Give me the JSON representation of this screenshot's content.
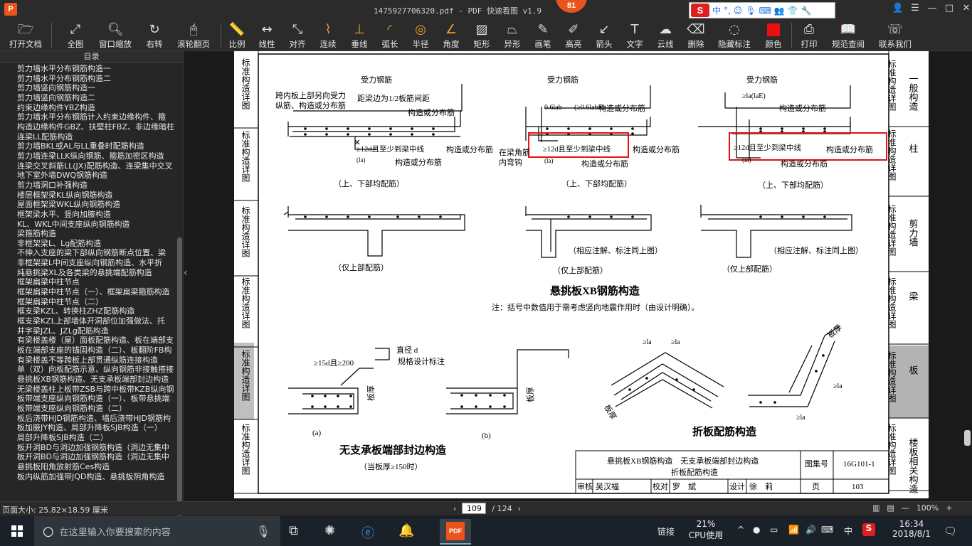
{
  "titlebar": {
    "logo": "P",
    "title": "1475927706320.pdf - PDF 快速看图 v1.9",
    "badge": "81",
    "ime_logo": "S",
    "ime_lang": "中",
    "minimize": "—",
    "maximize": "□",
    "close": "✕"
  },
  "toolbar": {
    "items": [
      "打开文档",
      "全图",
      "窗口缩放",
      "右转",
      "滚轮翻页",
      "比例",
      "线性",
      "对齐",
      "连续",
      "垂线",
      "弧长",
      "半径",
      "角度",
      "矩形",
      "异形",
      "画笔",
      "高亮",
      "箭头",
      "文字",
      "云线",
      "删除",
      "隐藏标注",
      "颜色",
      "打印",
      "规范查阅",
      "联系我们"
    ],
    "color_accent": "#e8a030",
    "highlight_red": "#e81010"
  },
  "sidebar": {
    "header": "目录",
    "items": [
      "剪力墙水平分布钢筋构造一",
      "剪力墙水平分布钢筋构造二",
      "剪力墙竖向钢筋构造一",
      "剪力墙竖向钢筋构造二",
      "约束边缘构件YBZ构造",
      "剪力墙水平分布钢筋计入约束边缘构件、箍",
      "构造边缘构件GBZ、扶壁柱FBZ、非边缘暗柱",
      "连梁LL配筋构造",
      "剪力墙BKL或AL与LL重叠时配筋构造",
      "剪力墙连梁LLK纵向钢筋、箍筋加密区构造",
      "连梁交叉斜筋LL(JX)配筋构造、连梁集中交叉",
      "地下室外墙DWQ钢筋构造",
      "剪力墙洞口补强构造",
      "楼层框架梁KL纵向钢筋构造",
      "屋面框架梁WKL纵向钢筋构造",
      "框架梁水平、竖向加腋构造",
      "KL、WKL中间支座纵向钢筋构造",
      "梁箍筋构造",
      "非框架梁L、Lg配筋构造",
      "不伸入支座的梁下部纵向钢筋断点位置、梁",
      "非框架梁L中间支座纵向钢筋构造、水平折",
      "纯悬挑梁XL及各类梁的悬挑端配筋构造",
      "框架扁梁中柱节点",
      "框架扁梁中柱节点（一）、框架扁梁箍筋构造",
      "框架扁梁中柱节点（二）",
      "框支梁KZL、转换柱ZHZ配筋构造",
      "框支梁KZL上部墙体开洞部位加强做法、托",
      "井字梁JZL、JZLg配筋构造",
      "有梁楼盖楼（屋）面板配筋构造、板在端部支",
      "板在端部支座的锚固构造（二）、板翻阶FB构",
      "有梁楼盖不等跨板上部贯通纵筋连接构造",
      "单（双）向板配筋示意、纵向钢筋非接触搭接",
      "悬挑板XB钢筋构造、无支承板端部封边构造",
      "无梁楼盖柱上板带ZSB与跨中板带KZB纵向钢",
      "板带端支座纵向钢筋构造（一）、板带悬挑端",
      "板带端支座纵向钢筋构造（二）",
      "板后浇带HJD钢筋构造、墙后浇带HJD钢筋构",
      "板加腋JY构造、局部升降板SJB构造（一）",
      "局部升降板SJB构造（二）",
      "板开洞BD与洞边加强钢筋构造（洞边无集中",
      "板开洞BD与洞边加强钢筋构造（洞边无集中",
      "悬挑板阳角放射筋Ces构造",
      "板内纵筋加强带JQD构造、悬挑板阴角构造"
    ]
  },
  "status": {
    "page_size": "页面大小: 25.82×18.59 厘米",
    "current_page": "109",
    "total_pages": "/ 124",
    "zoom": "100%"
  },
  "taskbar": {
    "search_placeholder": "在这里输入你要搜索的内容",
    "cpu_pct": "21%",
    "cpu_label": "CPU使用",
    "link_label": "链接",
    "lang": "中",
    "time": "16:34",
    "date": "2018/8/1",
    "pinned_label": "PDF"
  },
  "drawing": {
    "left_tabs": [
      "标准构造详图",
      "标准构造详图",
      "标准构造详图",
      "标准构造详图",
      "标准构造详图",
      "标准构造详图"
    ],
    "right_tabs": [
      {
        "title": "标准构造详图",
        "label": "一般构造"
      },
      {
        "title": "标准构造详图",
        "label": "柱"
      },
      {
        "title": "标准构造详图",
        "label": "剪力墙"
      },
      {
        "title": "标准构造详图",
        "label": "梁"
      },
      {
        "title": "标准构造详图",
        "label": "板"
      },
      {
        "title": "标准构造详图",
        "label": "楼板相关构造"
      }
    ],
    "labels": {
      "force_bar": "受力钢筋",
      "span_note_1": "跨内板上部另向受力",
      "span_note_2": "纵筋、构造或分布筋",
      "beam_edge": "距梁边为1/2板筋间距",
      "dist_bar": "构造或分布筋",
      "dist_bar2": "构造或分布筋",
      "anchor12d": "≥12d且至少到梁中线",
      "la": "(la)",
      "corner_1": "在梁角筋",
      "corner_2": "内弯钩",
      "both": "（上、下部均配筋）",
      "top_only": "（仅上部配筋）",
      "same_note": "（相应注解、标注同上图）",
      "cant_title": "悬挑板XB钢筋构造",
      "note": "注：括号中数值用于需考虑竖向地震作用时（由设计明确）。",
      "diam": "直径 d",
      "spec": "规格设计标注",
      "d15": "≥15d且≥200",
      "thick": "板厚",
      "a": "(a)",
      "b": "(b)",
      "end_title": "无支承板端部封边构造",
      "end_sub": "（当板厚≥150时）",
      "fold_title": "折板配筋构造",
      "t1": "0.6lab",
      "t2": "(≥0.6labE)",
      "t3": "≥la(laE)",
      "t4": "≥la",
      "t5": "≥la"
    },
    "titleblock": {
      "name1": "悬挑板XB钢筋构造　无支承板端部封边构造",
      "name2": "折板配筋构造",
      "atlas_label": "图集号",
      "atlas": "16G101-1",
      "review": "审核",
      "reviewer": "吴汉福",
      "check": "校对",
      "checker": "罗　斌",
      "design": "设计",
      "designer": "徐　莉",
      "page_label": "页",
      "page": "103"
    }
  }
}
